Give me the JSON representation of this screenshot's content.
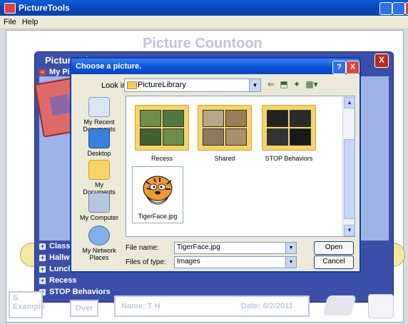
{
  "app": {
    "title": "PictureTools",
    "menu": [
      "File",
      "Help"
    ],
    "bg_title": "Picture Countoon"
  },
  "chooser": {
    "title": "Picture Ch",
    "my_pict": "My Pict",
    "categories": [
      "Classro",
      "Hallway",
      "Lunchro",
      "Recess",
      "STOP Behaviors"
    ]
  },
  "bottom": {
    "left1": "S",
    "left2": "Example",
    "over": "Over",
    "name": "Name: T H",
    "date": "Date: 6/2/2011"
  },
  "dialog": {
    "title": "Choose a picture.",
    "look_in_label": "Look in:",
    "look_in_value": "PictureLibrary",
    "places": [
      "My Recent Documents",
      "Desktop",
      "My Documents",
      "My Computer",
      "My Network Places"
    ],
    "items": [
      "Recess",
      "Shared",
      "STOP Behaviors",
      "TigerFace.jpg"
    ],
    "file_name_label": "File name:",
    "file_name_value": "TigerFace.jpg",
    "file_type_label": "Files of type:",
    "file_type_value": "Images",
    "open": "Open",
    "cancel": "Cancel",
    "help": "?",
    "close": "X"
  },
  "colors": {
    "titlebar": "#0a4fc8",
    "panel": "#3b4fa8",
    "dialog_bg": "#ece9d8"
  }
}
